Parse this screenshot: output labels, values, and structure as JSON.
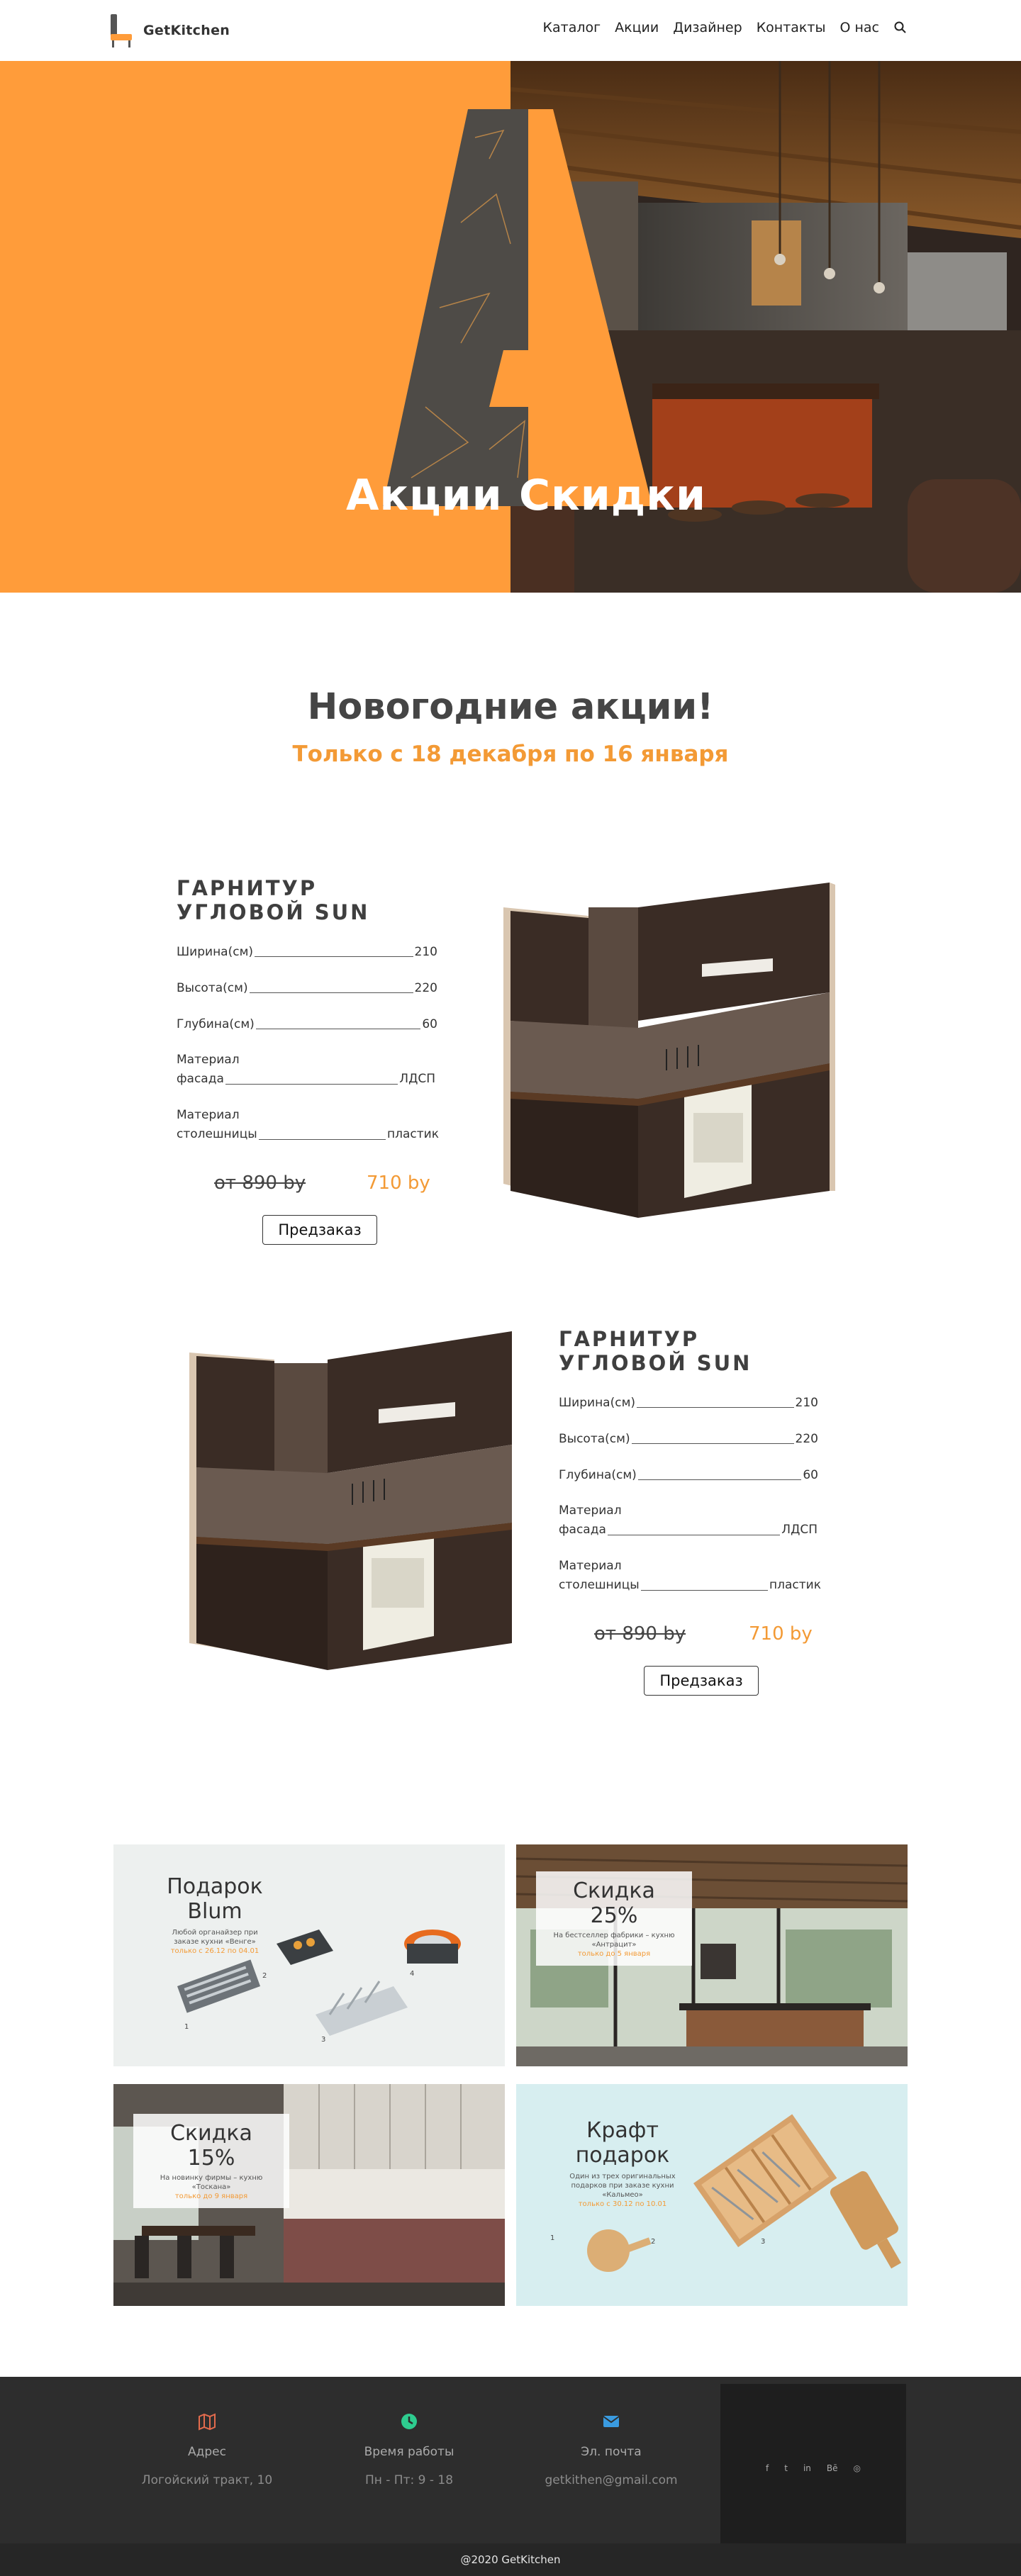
{
  "header": {
    "brand": "GetKitchen",
    "nav": [
      "Каталог",
      "Акции",
      "Дизайнер",
      "Контакты",
      "О нас"
    ]
  },
  "hero": {
    "letter": "A",
    "word_left": "Акции",
    "word_right": "Скидки"
  },
  "promo_section": {
    "title": "Новогодние акции!",
    "subtitle": "Только с 18 декабря по 16 января"
  },
  "products": [
    {
      "title": "ГАРНИТУР УГЛОВОЙ SUN",
      "specs": [
        {
          "label": "Ширина(см)",
          "value": "210"
        },
        {
          "label": "Высота(см)",
          "value": "220"
        },
        {
          "label": "Глубина(см)",
          "value": "60"
        }
      ],
      "facade_label_1": "Материал",
      "facade_label_2": "фасада",
      "facade_value": "ЛДСП",
      "top_label_1": "Материал",
      "top_label_2": "столешницы",
      "top_value": "пластик",
      "price_old": "от 890 by",
      "price_new": "710 by",
      "button": "Предзаказ"
    },
    {
      "title": "ГАРНИТУР УГЛОВОЙ SUN",
      "specs": [
        {
          "label": "Ширина(см)",
          "value": "210"
        },
        {
          "label": "Высота(см)",
          "value": "220"
        },
        {
          "label": "Глубина(см)",
          "value": "60"
        }
      ],
      "facade_label_1": "Материал",
      "facade_label_2": "фасада",
      "facade_value": "ЛДСП",
      "top_label_1": "Материал",
      "top_label_2": "столешницы",
      "top_value": "пластик",
      "price_old": "от 890 by",
      "price_new": "710 by",
      "button": "Предзаказ"
    }
  ],
  "promos": [
    {
      "title": "Подарок Blum",
      "desc_1": "Любой органайзер при",
      "desc_2": "заказе кухни «Венге»",
      "date": "только с 26.12 по 04.01",
      "items": [
        "1",
        "2",
        "3",
        "4"
      ]
    },
    {
      "title": "Скидка 25%",
      "desc_1": "На бестселлер фабрики – кухню",
      "desc_2": "«Антрацит»",
      "date": "только до 5 января"
    },
    {
      "title": "Скидка 15%",
      "desc_1": "На новинку фирмы – кухню",
      "desc_2": "«Тоскана»",
      "date": "только до 9 января"
    },
    {
      "title": "Крафт подарок",
      "desc_1": "Один из трех оригинальных",
      "desc_2": "подарков при заказе кухни",
      "desc_3": "«Кальмео»",
      "date": "только с 30.12 по 10.01",
      "items": [
        "1",
        "2",
        "3"
      ]
    }
  ],
  "footer": {
    "address_label": "Адрес",
    "address_value": "Логойский тракт, 10",
    "hours_label": "Время работы",
    "hours_value": "Пн - Пт: 9 - 18",
    "email_label": "Эл. почта",
    "email_value": "getkithen@gmail.com",
    "social": [
      "f",
      "t",
      "in",
      "Bē",
      "◎"
    ],
    "copyright": "@2020 GetKitchen"
  },
  "colors": {
    "accent": "#ff9c3a",
    "accent_text": "#f39a35",
    "footer_bg": "#2d2d2d"
  }
}
